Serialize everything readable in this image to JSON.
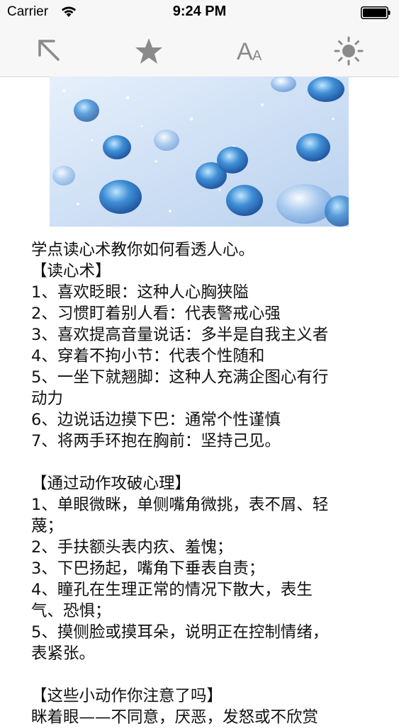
{
  "status_bar": {
    "carrier": "Carrier",
    "time": "9:24 PM"
  },
  "toolbar": {
    "icons": [
      "back-arrow-icon",
      "star-icon",
      "font-size-icon",
      "brightness-icon"
    ],
    "font_big": "A",
    "font_small": "A",
    "icon_color": "#8a8a8a"
  },
  "article": {
    "lines": [
      "学点读心术教你如何看透人心。",
      " 【读心术】",
      "1、喜欢眨眼：这种人心胸狭隘",
      "2、习惯盯着别人看：代表警戒心强",
      "3、喜欢提高音量说话：多半是自我主义者",
      "4、穿着不拘小节：代表个性随和",
      "5、一坐下就翘脚：这种人充满企图心有行",
      "动力",
      "6、边说话边摸下巴：通常个性谨慎",
      "7、将两手环抱在胸前：坚持己见。",
      "",
      "【通过动作攻破心理】",
      "1、单眼微眯，单侧嘴角微挑，表不屑、轻",
      "蔑；",
      "2、手扶额头表内疚、羞愧；",
      "3、下巴扬起，嘴角下垂表自责；",
      "4、瞳孔在生理正常的情况下散大，表生",
      "气、恐惧；",
      "5、摸侧脸或摸耳朵，说明正在控制情绪，",
      "表紧张。",
      "",
      "【这些小动作你注意了吗】",
      "眯着眼——不同意，厌恶，发怒或不欣赏"
    ]
  }
}
